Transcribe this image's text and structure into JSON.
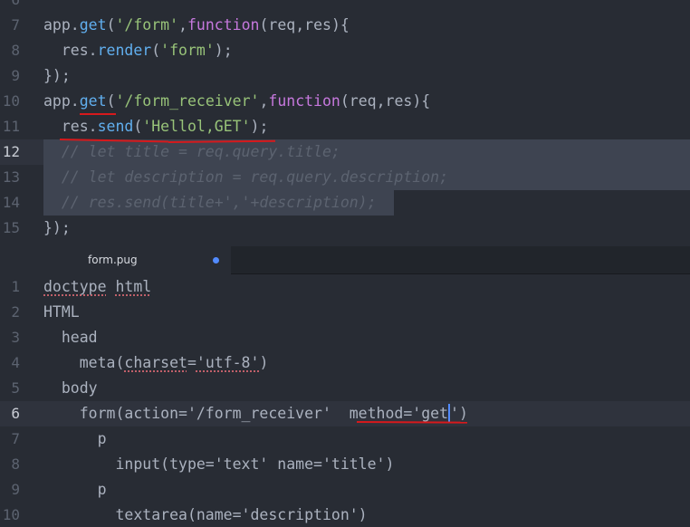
{
  "top_editor": {
    "lines": [
      {
        "num": "6",
        "tokens": []
      },
      {
        "num": "7",
        "tokens": [
          {
            "t": "app.",
            "c": "plain"
          },
          {
            "t": "get",
            "c": "fn"
          },
          {
            "t": "(",
            "c": "plain"
          },
          {
            "t": "'/form'",
            "c": "str"
          },
          {
            "t": ",",
            "c": "plain"
          },
          {
            "t": "function",
            "c": "kw"
          },
          {
            "t": "(req,res){",
            "c": "plain"
          }
        ]
      },
      {
        "num": "8",
        "tokens": [
          {
            "t": "  res.",
            "c": "plain"
          },
          {
            "t": "render",
            "c": "fn"
          },
          {
            "t": "(",
            "c": "plain"
          },
          {
            "t": "'form'",
            "c": "str"
          },
          {
            "t": ");",
            "c": "plain"
          }
        ]
      },
      {
        "num": "9",
        "tokens": [
          {
            "t": "});",
            "c": "plain"
          }
        ]
      },
      {
        "num": "10",
        "tokens": [
          {
            "t": "app.",
            "c": "plain"
          },
          {
            "t": "get",
            "c": "fn"
          },
          {
            "t": "(",
            "c": "plain"
          },
          {
            "t": "'/form_receiver'",
            "c": "str"
          },
          {
            "t": ",",
            "c": "plain"
          },
          {
            "t": "function",
            "c": "kw"
          },
          {
            "t": "(req,res){",
            "c": "plain"
          }
        ]
      },
      {
        "num": "11",
        "tokens": [
          {
            "t": "  res.",
            "c": "plain"
          },
          {
            "t": "send",
            "c": "fn"
          },
          {
            "t": "(",
            "c": "plain"
          },
          {
            "t": "'Hellol,GET'",
            "c": "str"
          },
          {
            "t": ");",
            "c": "plain"
          }
        ]
      },
      {
        "num": "12",
        "tokens": [
          {
            "t": "  // let title = req.query.title;",
            "c": "cm"
          }
        ]
      },
      {
        "num": "13",
        "tokens": [
          {
            "t": "  // let description = req.query.description;",
            "c": "cm"
          }
        ]
      },
      {
        "num": "14",
        "tokens": [
          {
            "t": "  // res.send(title+','+description);",
            "c": "cm"
          }
        ]
      },
      {
        "num": "15",
        "tokens": [
          {
            "t": "});",
            "c": "plain"
          }
        ]
      }
    ]
  },
  "tab": {
    "title": "form.pug",
    "modified": true
  },
  "bottom_editor": {
    "lines": [
      {
        "num": "1",
        "tokens": [
          {
            "t": "doctype",
            "c": "plain squig"
          },
          {
            "t": " ",
            "c": "plain"
          },
          {
            "t": "html",
            "c": "plain squig"
          }
        ]
      },
      {
        "num": "2",
        "tokens": [
          {
            "t": "HTML",
            "c": "plain"
          }
        ]
      },
      {
        "num": "3",
        "tokens": [
          {
            "t": "  head",
            "c": "plain"
          }
        ]
      },
      {
        "num": "4",
        "tokens": [
          {
            "t": "    meta(",
            "c": "plain"
          },
          {
            "t": "charset",
            "c": "plain squig"
          },
          {
            "t": "=",
            "c": "plain"
          },
          {
            "t": "'utf-8'",
            "c": "plain squig"
          },
          {
            "t": ")",
            "c": "plain"
          }
        ]
      },
      {
        "num": "5",
        "tokens": [
          {
            "t": "  body",
            "c": "plain"
          }
        ]
      },
      {
        "num": "6",
        "tokens": [
          {
            "t": "    form(action='/form_receiver'  method='get",
            "c": "plain"
          },
          {
            "t": "",
            "c": "cursor"
          },
          {
            "t": "')",
            "c": "plain"
          }
        ]
      },
      {
        "num": "7",
        "tokens": [
          {
            "t": "      p",
            "c": "plain"
          }
        ]
      },
      {
        "num": "8",
        "tokens": [
          {
            "t": "        input(type='text' name='title')",
            "c": "plain"
          }
        ]
      },
      {
        "num": "9",
        "tokens": [
          {
            "t": "      p",
            "c": "plain"
          }
        ]
      },
      {
        "num": "10",
        "tokens": [
          {
            "t": "        textarea(name='description')",
            "c": "plain"
          }
        ]
      }
    ]
  },
  "colors": {
    "background": "#282c34",
    "selection": "#3e4451",
    "string": "#98c379",
    "function": "#61afef",
    "keyword": "#c678dd",
    "comment": "#5c6370",
    "annotation_red": "#d7191c",
    "cursor": "#528bff"
  }
}
